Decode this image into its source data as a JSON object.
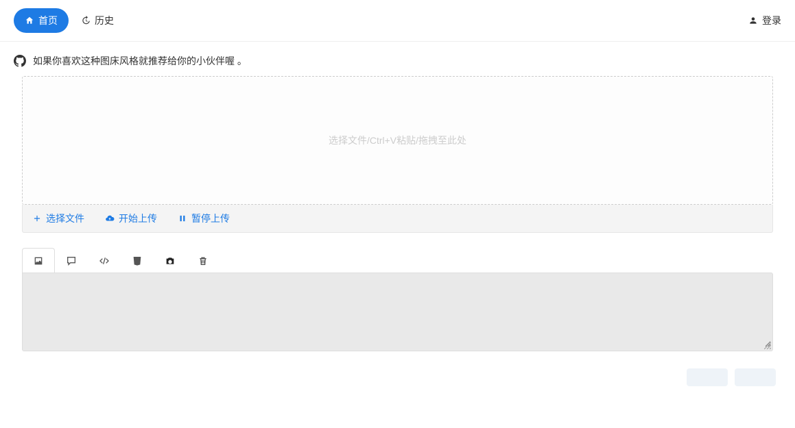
{
  "nav": {
    "home_label": "首页",
    "history_label": "历史",
    "login_label": "登录"
  },
  "notice": {
    "text": "如果你喜欢这种图床风格就推荐给你的小伙伴喔 。"
  },
  "dropzone": {
    "placeholder": "选择文件/Ctrl+V粘贴/拖拽至此处"
  },
  "actions": {
    "select_label": "选择文件",
    "start_label": "开始上传",
    "pause_label": "暂停上传"
  },
  "tabs": {
    "image": "image",
    "comment": "comment",
    "code": "code",
    "html5": "html5",
    "camera": "camera",
    "trash": "trash"
  },
  "output": {
    "value": ""
  }
}
